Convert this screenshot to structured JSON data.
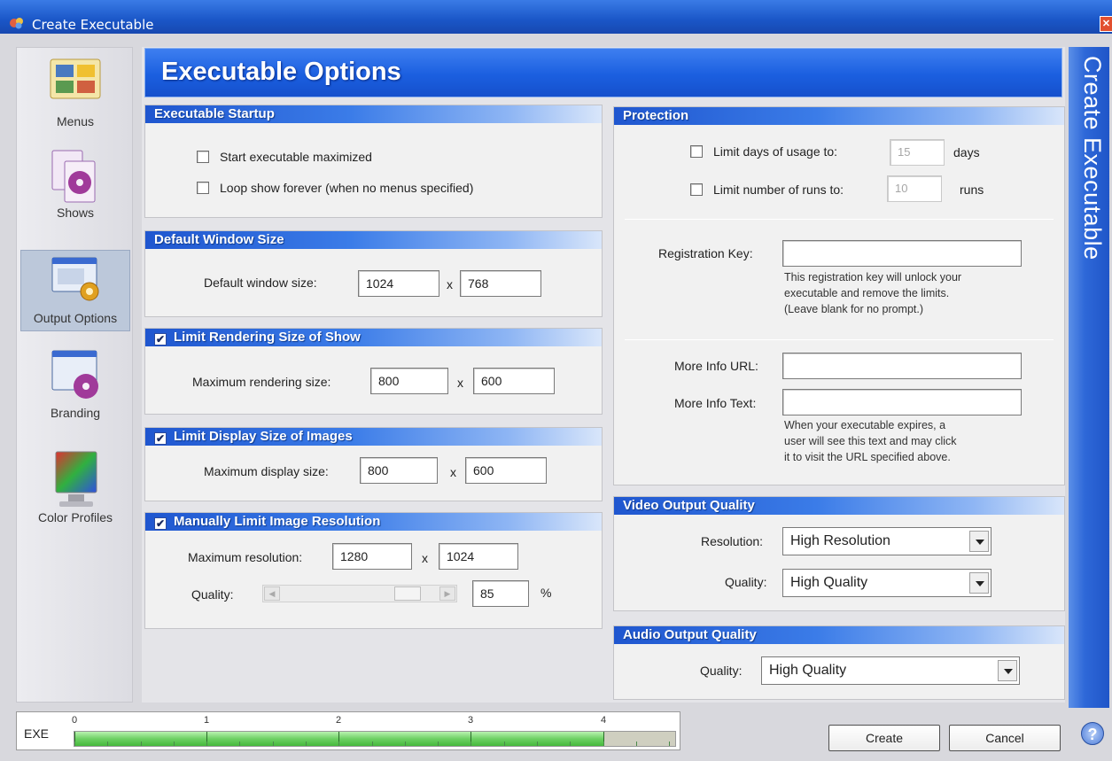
{
  "window": {
    "title": "Create Executable",
    "close_glyph": "✕"
  },
  "sidebar": {
    "items": [
      {
        "label": "Menus"
      },
      {
        "label": "Shows"
      },
      {
        "label": "Output Options"
      },
      {
        "label": "Branding"
      },
      {
        "label": "Color Profiles"
      }
    ]
  },
  "page_title": "Executable Options",
  "banner_text": "Create Executable",
  "startup": {
    "title": "Executable Startup",
    "maximized_label": "Start executable maximized",
    "loop_label": "Loop show forever (when no menus specified)"
  },
  "window_size": {
    "title": "Default Window Size",
    "label": "Default window size:",
    "width": "1024",
    "x": "x",
    "height": "768"
  },
  "render_size": {
    "title": "Limit Rendering Size of Show",
    "label": "Maximum rendering size:",
    "width": "800",
    "x": "x",
    "height": "600"
  },
  "display_size": {
    "title": "Limit Display Size of Images",
    "label": "Maximum display size:",
    "width": "800",
    "x": "x",
    "height": "600"
  },
  "resolution": {
    "title": "Manually Limit Image Resolution",
    "label": "Maximum resolution:",
    "width": "1280",
    "x": "x",
    "height": "1024",
    "quality_label": "Quality:",
    "quality_value": "85",
    "quality_unit": "%",
    "slider_fraction": 0.85
  },
  "protection": {
    "title": "Protection",
    "days_label": "Limit days of usage to:",
    "days_value": "15",
    "days_unit": "days",
    "runs_label": "Limit number of runs to:",
    "runs_value": "10",
    "runs_unit": "runs",
    "reg_label": "Registration Key:",
    "reg_help_1": "This registration key will unlock your",
    "reg_help_2": "executable and remove the limits.",
    "reg_help_3": "(Leave blank for no prompt.)",
    "url_label": "More Info URL:",
    "text_label": "More Info Text:",
    "info_help_1": "When your executable expires, a",
    "info_help_2": "user will see this text and may click",
    "info_help_3": "it to visit the URL specified above."
  },
  "video": {
    "title": "Video Output Quality",
    "resolution_label": "Resolution:",
    "resolution_value": "High Resolution",
    "quality_label": "Quality:",
    "quality_value": "High Quality"
  },
  "audio": {
    "title": "Audio Output Quality",
    "quality_label": "Quality:",
    "quality_value": "High Quality"
  },
  "footer": {
    "exe_label": "EXE",
    "ticks": [
      "0",
      "1",
      "2",
      "3",
      "4"
    ],
    "progress_fraction": 0.88,
    "create_label": "Create",
    "cancel_label": "Cancel"
  },
  "help_glyph": "?",
  "check_glyph": "✔"
}
